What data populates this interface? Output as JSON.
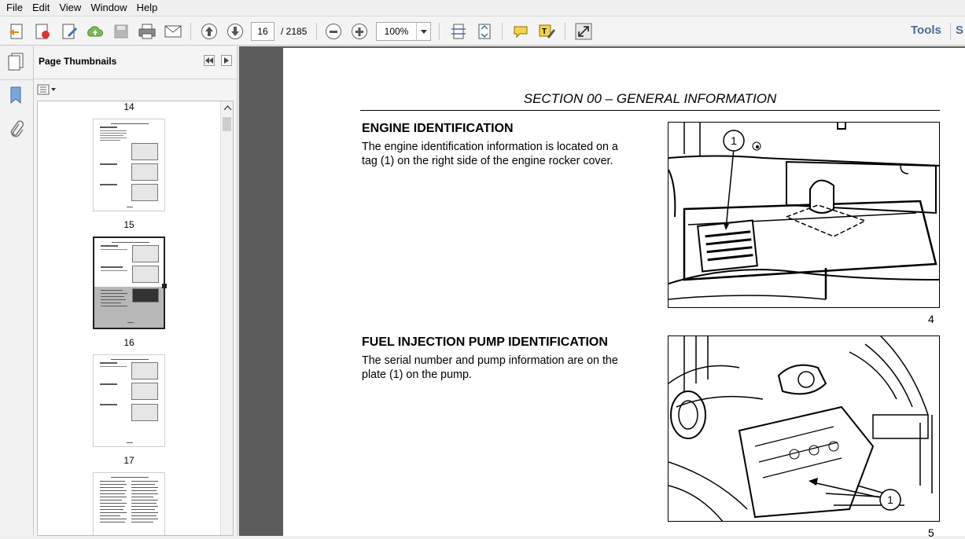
{
  "menu": [
    "File",
    "Edit",
    "View",
    "Window",
    "Help"
  ],
  "toolbar": {
    "page_current": "16",
    "page_total": "/ 2185",
    "zoom": "100%",
    "tools_label": "Tools",
    "tools_overflow": "S"
  },
  "panel": {
    "title": "Page Thumbnails",
    "thumbnails": [
      {
        "label": "14"
      },
      {
        "label": "15"
      },
      {
        "label": "16"
      },
      {
        "label": "17"
      }
    ]
  },
  "document": {
    "section_heading": "SECTION 00 – GENERAL INFORMATION",
    "sections": [
      {
        "heading": "ENGINE IDENTIFICATION",
        "body_line1": "The engine identification information is located on a",
        "body_line2": "tag (1) on the right side of the engine rocker cover.",
        "figure_number": "4",
        "callout": "1"
      },
      {
        "heading": "FUEL INJECTION PUMP IDENTIFICATION",
        "body_line1": "The serial number and pump information are on the",
        "body_line2": "plate (1) on the pump.",
        "figure_number": "5",
        "callout": "1"
      }
    ]
  }
}
